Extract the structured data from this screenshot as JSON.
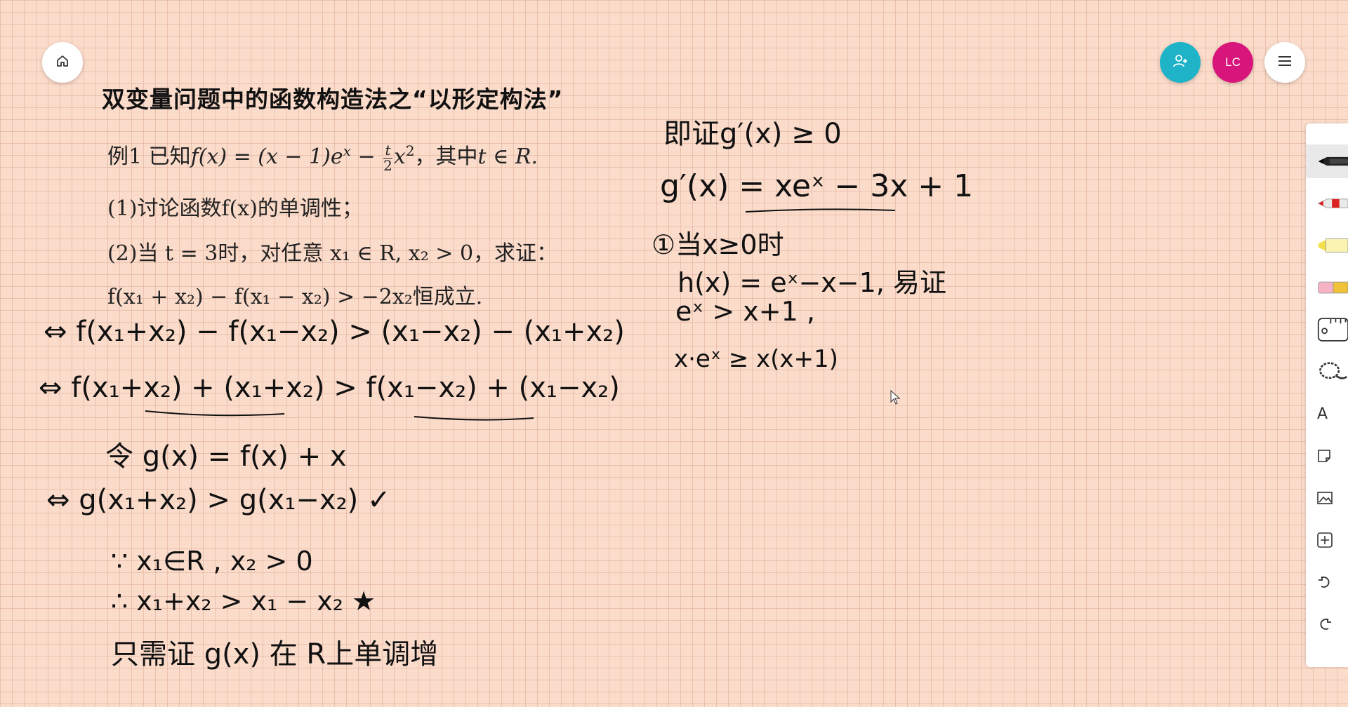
{
  "title": "双变量问题中的函数构造法之“以形定构法”",
  "avatar_initials": "LC",
  "problem": {
    "line1_prefix": "例1  已知",
    "line1_func": "f(x) = (x − 1)e",
    "line1_exp": "x",
    "line1_minus": " − ",
    "frac_num": "t",
    "frac_den": "2",
    "line1_x2": "x",
    "line1_sq": "2",
    "line1_suffix": "，其中",
    "line1_cond": "t ∈ R.",
    "line2": "(1)讨论函数f(x)的单调性；",
    "line3": "(2)当 t = 3时，对任意 x₁ ∈ R, x₂ > 0，求证：",
    "line4": "f(x₁ + x₂) − f(x₁ − x₂) > −2x₂恒成立."
  },
  "handwritten_left": [
    "⇔  f(x₁+x₂) − f(x₁−x₂) > (x₁−x₂) − (x₁+x₂)",
    "⇔  f(x₁+x₂) + (x₁+x₂) > f(x₁−x₂) + (x₁−x₂)",
    "令 g(x) = f(x) + x",
    "⇔  g(x₁+x₂) > g(x₁−x₂) ✓",
    "∵ x₁∈R , x₂ > 0",
    "∴ x₁+x₂ > x₁ − x₂ ★",
    "只需证 g(x) 在 R上单调增"
  ],
  "handwritten_right": [
    "即证g′(x) ≥ 0",
    "g′(x) = xeˣ − 3x + 1",
    "①当x≥0时",
    "h(x) = eˣ−x−1, 易证",
    "eˣ > x+1 ,",
    "x·eˣ ≥ x(x+1)"
  ],
  "colors": {
    "canvas": "#fbdccb",
    "share": "#1fb3c8",
    "avatar": "#d8157a"
  },
  "toolbar_icons": [
    "pen-black-icon",
    "pen-red-icon",
    "highlighter-icon",
    "eraser-icon",
    "ruler-icon",
    "lasso-icon",
    "text-icon",
    "sticky-note-icon",
    "image-icon",
    "add-icon",
    "undo-icon",
    "redo-icon"
  ],
  "text_tool_label": "A"
}
